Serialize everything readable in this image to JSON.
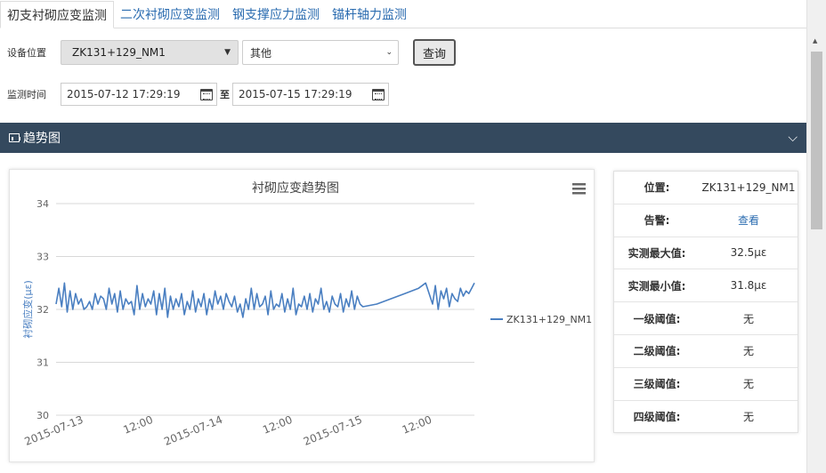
{
  "tabs": [
    {
      "label": "初支衬砌应变监测",
      "active": true
    },
    {
      "label": "二次衬砌应变监测",
      "active": false
    },
    {
      "label": "钢支撑应力监测",
      "active": false
    },
    {
      "label": "锚杆轴力监测",
      "active": false
    }
  ],
  "filters": {
    "device_label": "设备位置",
    "device_value": "ZK131+129_NM1",
    "type_value": "其他",
    "query_label": "查询",
    "time_label": "监测时间",
    "start_value": "2015-07-12 17:29:19",
    "to_label": "至",
    "end_value": "2015-07-15 17:29:19"
  },
  "section": {
    "title": "趋势图"
  },
  "info": {
    "rows": [
      {
        "key": "位置:",
        "value": "ZK131+129_NM1"
      },
      {
        "key": "告警:",
        "value": "查看"
      },
      {
        "key": "实测最大值:",
        "value": "32.5με"
      },
      {
        "key": "实测最小值:",
        "value": "31.8με"
      },
      {
        "key": "一级阈值:",
        "value": "无"
      },
      {
        "key": "二级阈值:",
        "value": "无"
      },
      {
        "key": "三级阈值:",
        "value": "无"
      },
      {
        "key": "四级阈值:",
        "value": "无"
      }
    ]
  },
  "chart_data": {
    "type": "line",
    "title": "衬砌应变趋势图",
    "ylabel": "衬砌应变(με)",
    "xlabel": "",
    "ylim": [
      30,
      34
    ],
    "yticks": [
      30,
      31,
      32,
      33,
      34
    ],
    "xlim": [
      0,
      3.0
    ],
    "xtick_labels": [
      {
        "t": 0.2,
        "label": "2015-07-13"
      },
      {
        "t": 0.7,
        "label": "12:00"
      },
      {
        "t": 1.2,
        "label": "2015-07-14"
      },
      {
        "t": 1.7,
        "label": "12:00"
      },
      {
        "t": 2.2,
        "label": "2015-07-15"
      },
      {
        "t": 2.7,
        "label": "12:00"
      }
    ],
    "legend_position": "right",
    "series": [
      {
        "name": "ZK131+129_NM1",
        "color": "#4a7fc1",
        "x": [
          0.0,
          0.02,
          0.04,
          0.06,
          0.08,
          0.1,
          0.12,
          0.14,
          0.16,
          0.18,
          0.2,
          0.22,
          0.24,
          0.26,
          0.28,
          0.3,
          0.32,
          0.34,
          0.36,
          0.38,
          0.4,
          0.42,
          0.44,
          0.46,
          0.48,
          0.5,
          0.52,
          0.54,
          0.56,
          0.58,
          0.6,
          0.62,
          0.64,
          0.66,
          0.68,
          0.7,
          0.72,
          0.74,
          0.76,
          0.78,
          0.8,
          0.82,
          0.84,
          0.86,
          0.88,
          0.9,
          0.92,
          0.94,
          0.96,
          0.98,
          1.0,
          1.02,
          1.04,
          1.06,
          1.08,
          1.1,
          1.12,
          1.14,
          1.16,
          1.18,
          1.2,
          1.22,
          1.24,
          1.26,
          1.28,
          1.3,
          1.32,
          1.34,
          1.36,
          1.38,
          1.4,
          1.42,
          1.44,
          1.46,
          1.48,
          1.5,
          1.52,
          1.54,
          1.56,
          1.58,
          1.6,
          1.62,
          1.64,
          1.66,
          1.68,
          1.7,
          1.72,
          1.74,
          1.76,
          1.78,
          1.8,
          1.82,
          1.84,
          1.86,
          1.88,
          1.9,
          1.92,
          1.94,
          1.96,
          1.98,
          2.0,
          2.02,
          2.04,
          2.06,
          2.08,
          2.1,
          2.12,
          2.14,
          2.16,
          2.18,
          2.2,
          2.3,
          2.4,
          2.5,
          2.6,
          2.65,
          2.7,
          2.72,
          2.74,
          2.76,
          2.78,
          2.8,
          2.82,
          2.84,
          2.86,
          2.88,
          2.9,
          2.92,
          2.94,
          2.96,
          2.98,
          3.0
        ],
        "values": [
          32.1,
          32.4,
          32.05,
          32.5,
          31.95,
          32.35,
          32.0,
          32.3,
          32.1,
          32.2,
          32.0,
          32.05,
          32.15,
          32.0,
          32.3,
          32.1,
          32.25,
          32.2,
          32.0,
          32.4,
          32.1,
          32.3,
          31.95,
          32.35,
          32.0,
          32.2,
          32.1,
          32.15,
          31.9,
          32.45,
          32.0,
          32.3,
          32.05,
          32.2,
          32.1,
          32.35,
          31.9,
          32.3,
          32.0,
          32.4,
          31.85,
          32.25,
          32.0,
          32.2,
          32.05,
          32.3,
          31.9,
          32.15,
          32.0,
          32.35,
          31.95,
          32.2,
          32.05,
          32.3,
          31.9,
          32.2,
          32.0,
          32.35,
          32.1,
          32.25,
          32.0,
          32.3,
          32.15,
          32.05,
          32.25,
          31.95,
          32.1,
          31.85,
          32.2,
          32.0,
          32.4,
          32.0,
          32.3,
          32.05,
          32.1,
          32.25,
          31.9,
          32.35,
          32.0,
          32.1,
          32.05,
          32.3,
          31.95,
          32.2,
          32.0,
          32.4,
          31.9,
          32.1,
          32.05,
          32.25,
          32.0,
          32.3,
          31.95,
          32.2,
          32.1,
          32.4,
          32.0,
          32.15,
          31.95,
          32.25,
          32.1,
          32.05,
          32.3,
          31.95,
          32.2,
          32.05,
          32.35,
          32.0,
          32.25,
          32.1,
          32.05,
          32.1,
          32.2,
          32.3,
          32.4,
          32.5,
          32.1,
          32.45,
          32.0,
          32.35,
          32.2,
          32.4,
          32.05,
          32.3,
          32.2,
          32.15,
          32.4,
          32.25,
          32.35,
          32.3,
          32.4,
          32.5
        ]
      }
    ]
  }
}
